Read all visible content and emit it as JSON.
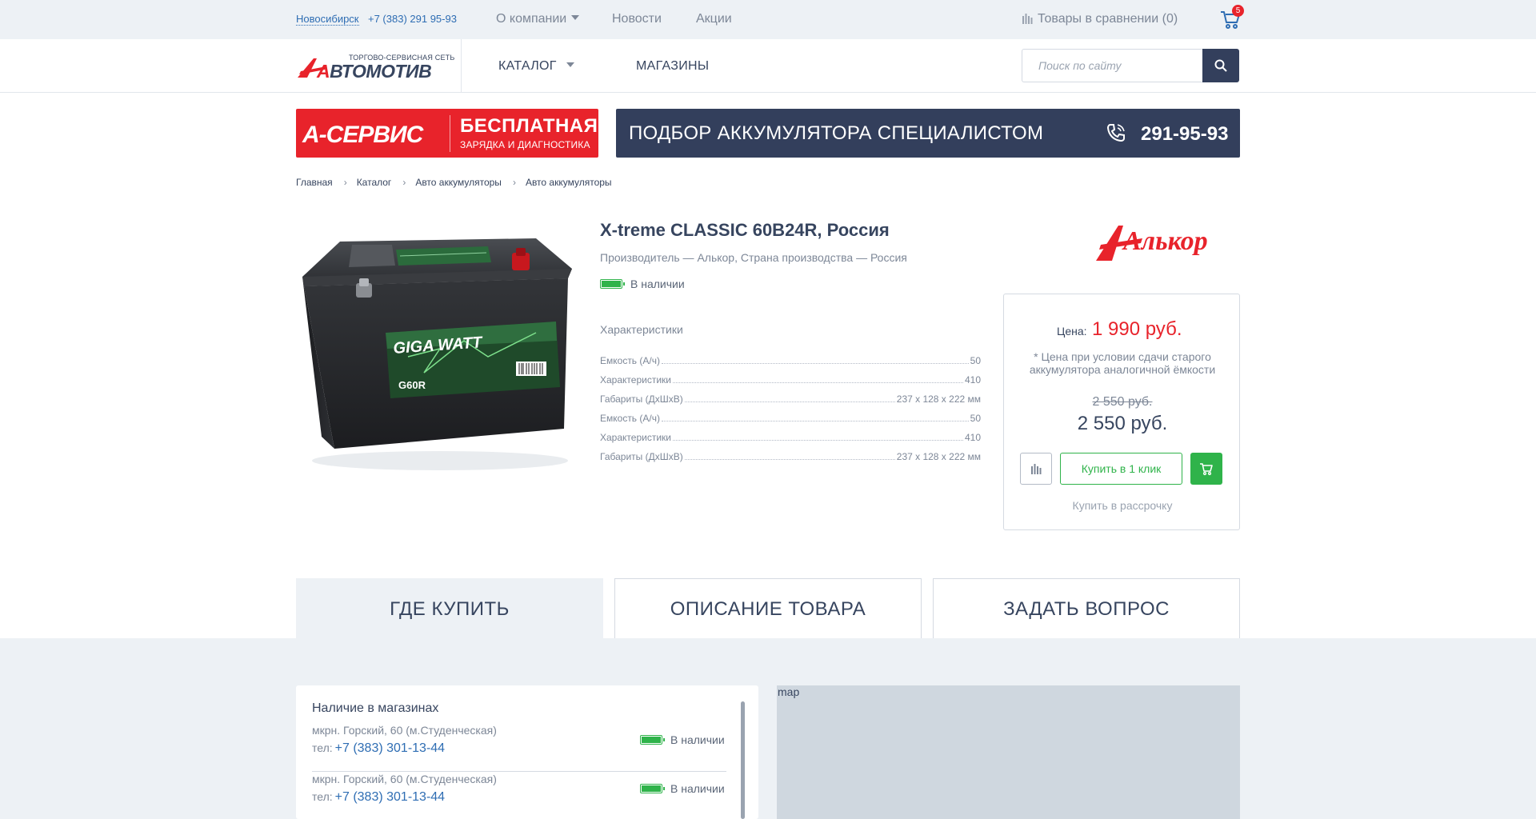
{
  "topbar": {
    "city": "Новосибирск",
    "phone": "+7 (383) 291 95-93",
    "nav": [
      "О компании",
      "Новости",
      "Акции"
    ],
    "compare_label": "Товары в сравнении (0)",
    "cart_count": "5"
  },
  "header": {
    "logo_subtitle": "ТОРГОВО-СЕРВИСНАЯ СЕТЬ",
    "logo_first": "А",
    "logo_rest": "ВТОМОТИВ",
    "menu": [
      "КАТАЛОГ",
      "МАГАЗИНЫ"
    ],
    "search_placeholder": "Поиск по сайту"
  },
  "banners": {
    "service_logo": "А-СЕРВИС",
    "service_big": "БЕСПЛАТНАЯ",
    "service_small": "ЗАРЯДКА И ДИАГНОСТИКА",
    "selection_text": "ПОДБОР АККУМУЛЯТОРА СПЕЦИАЛИСТОМ",
    "selection_phone": "291-95-93"
  },
  "breadcrumb": [
    "Главная",
    "Каталог",
    "Авто аккумуляторы",
    "Авто аккумуляторы"
  ],
  "product": {
    "title": "X-treme CLASSIC 60B24R, Россия",
    "meta": "Производитель — Алькор, Страна производства — Россия",
    "stock": "В наличии",
    "brand": "Алькор",
    "image_label_brand": "GIGA WATT",
    "image_label_model": "G60R",
    "specs_title": "Характеристики",
    "specs": [
      {
        "k": "Емкость (А/ч)",
        "v": "50"
      },
      {
        "k": "Характеристики",
        "v": "410"
      },
      {
        "k": "Габариты (ДхШхВ)",
        "v": "237 x 128 x 222 мм"
      },
      {
        "k": "Емкость (А/ч)",
        "v": "50"
      },
      {
        "k": "Характеристики",
        "v": "410"
      },
      {
        "k": "Габариты (ДхШхВ)",
        "v": "237 x 128 x 222 мм"
      }
    ]
  },
  "price": {
    "label": "Цена:",
    "main": "1 990 руб.",
    "note": "* Цена при условии сдачи старого аккумулятора аналогичной ёмкости",
    "old": "2 550 руб.",
    "new": "2 550 руб.",
    "oneclick": "Купить в 1 клик",
    "installment": "Купить в рассрочку"
  },
  "tabs": [
    "ГДЕ КУПИТЬ",
    "ОПИСАНИЕ ТОВАРА",
    "ЗАДАТЬ ВОПРОС"
  ],
  "stores": {
    "title": "Наличие в магазинах",
    "tel_prefix": "тел:",
    "items": [
      {
        "address": "мкрн. Горский, 60 (м.Студенческая)",
        "phone": "+7 (383) 301-13-44",
        "stock": "В наличии"
      },
      {
        "address": "мкрн. Горский, 60 (м.Студенческая)",
        "phone": "+7 (383) 301-13-44",
        "stock": "В наличии"
      }
    ]
  },
  "map_label": "map",
  "colors": {
    "accent_red": "#e8232b",
    "navy": "#333f5c",
    "green": "#2fb34a",
    "link_blue": "#2e6db3"
  }
}
